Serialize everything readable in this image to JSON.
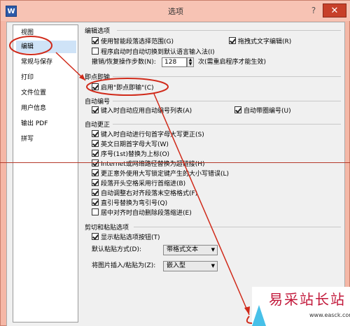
{
  "window": {
    "title": "选项",
    "app_icon": "W",
    "help_icon": "?",
    "close_icon": "✕",
    "accent": "#f5b7a6",
    "close_color": "#c7402a"
  },
  "sidebar": {
    "items": [
      {
        "label": "视图"
      },
      {
        "label": "编辑"
      },
      {
        "label": "常规与保存"
      },
      {
        "label": "打印"
      },
      {
        "label": "文件位置"
      },
      {
        "label": "用户信息"
      },
      {
        "label": "输出 PDF"
      },
      {
        "label": "拼写"
      }
    ],
    "selected": "编辑"
  },
  "edit_options": {
    "title": "编辑选项",
    "smart_para": {
      "label": "使用智能段落选择范围(G)",
      "checked": true
    },
    "drag_edit": {
      "label": "拖拽式文字编辑(R)",
      "checked": true
    },
    "auto_ime": {
      "label": "程序启动时自动切换到默认语言输入法(I)",
      "checked": false
    },
    "undo_steps": {
      "label": "撤销/恢复操作步数(N):",
      "value": "128",
      "suffix": "次(需重启程序才能生效)"
    }
  },
  "instant_input": {
    "title": "即点即输",
    "enable": {
      "label": "启用\"即点即输\"(C)",
      "checked": true
    }
  },
  "auto_number": {
    "title": "自动编号",
    "apply_list": {
      "label": "键入时自动应用自动编号列表(A)",
      "checked": true
    },
    "circle_number": {
      "label": "自动带圈编号(U)",
      "checked": true
    }
  },
  "auto_correct": {
    "title": "自动更正",
    "items": [
      {
        "label": "键入时自动进行句首字母大写更正(S)",
        "checked": true
      },
      {
        "label": "英文日期首字母大写(W)",
        "checked": true
      },
      {
        "label": "序号(1st)替换为上标(O)",
        "checked": true
      },
      {
        "label": "Internet或网络路径替换为超链接(H)",
        "checked": true
      },
      {
        "label": "更正意外使用大写锁定键产生的大小写错误(L)",
        "checked": true
      },
      {
        "label": "段落开头空格采用行首缩进(B)",
        "checked": true
      },
      {
        "label": "自动调整右对齐段落末空格格式(F)",
        "checked": true
      },
      {
        "label": "直引号替换为弯引号(Q)",
        "checked": true
      },
      {
        "label": "居中对齐时自动删除段落缩进(E)",
        "checked": false
      }
    ]
  },
  "clipboard": {
    "title": "剪切和粘贴选项",
    "show_paste_btn": {
      "label": "显示粘贴选项按钮(T)",
      "checked": true
    },
    "default_paste": {
      "label": "默认粘贴方式(D):",
      "value": "带格式文本"
    },
    "image_insert": {
      "label": "将图片插入/粘贴为(Z):",
      "value": "嵌入型"
    }
  },
  "watermark": {
    "cn": "易采站长站",
    "en": "www.easck.com"
  },
  "annotation_color": "#d02a1a"
}
